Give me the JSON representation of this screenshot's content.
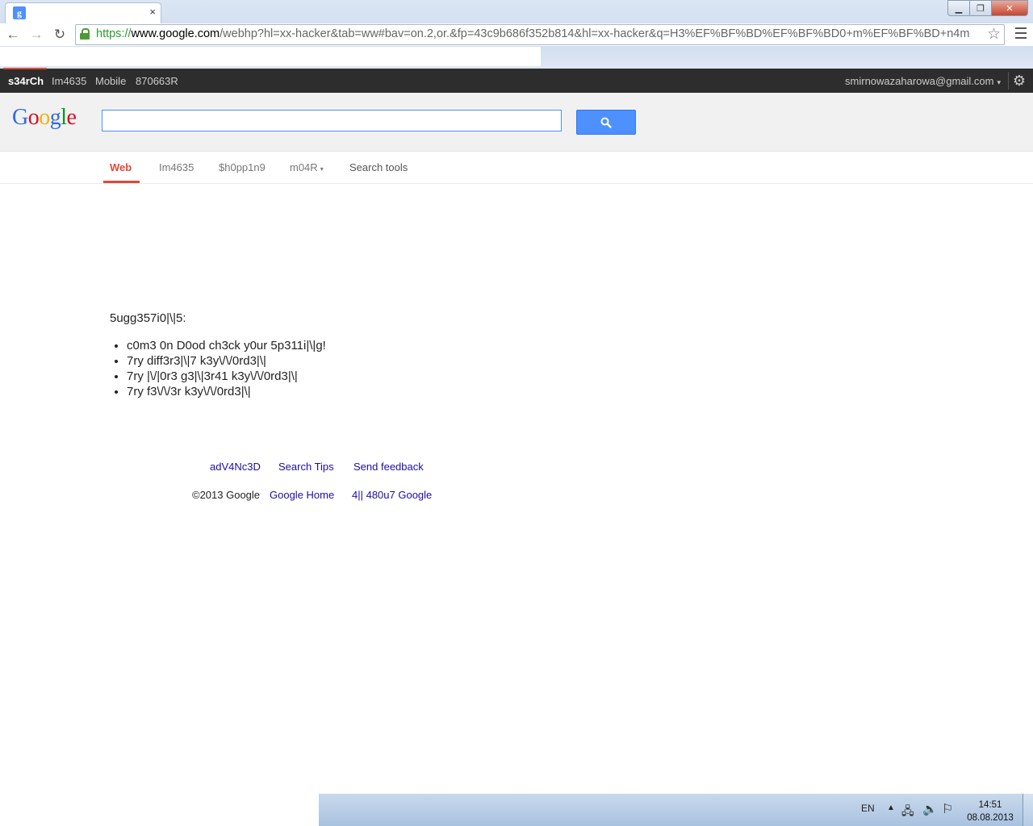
{
  "browser": {
    "tab_favicon": "g",
    "tab_close": "×",
    "window_controls": {
      "minimize": "▁",
      "maximize": "❐",
      "close": "✕"
    },
    "nav": {
      "back": "←",
      "forward": "→",
      "reload": "↻"
    },
    "url_scheme": "https://",
    "url_host": "www.google.com",
    "url_rest": "/webhp?hl=xx-hacker&tab=ww#bav=on.2,or.&fp=43c9b686f352b814&hl=xx-hacker&q=H3%EF%BF%BD%EF%BF%BD0+m%EF%BF%BD+n4m",
    "star": "☆"
  },
  "gbar": {
    "search": "s34rCh",
    "images": "Im4635",
    "mobile": "Mobile",
    "more": "870663R",
    "account": "smirnowazaharowa@gmail.com",
    "account_caret": "▾",
    "gear": "⚙"
  },
  "search": {
    "logo": {
      "G": "G",
      "o1": "o",
      "o2": "o",
      "g": "g",
      "l": "l",
      "e": "e"
    },
    "query": ""
  },
  "tabs": {
    "web": "Web",
    "images": "Im4635",
    "shopping": "$h0pp1n9",
    "more": "m04R",
    "more_caret": "▾",
    "tools": "Search tools"
  },
  "suggestions": {
    "heading": "5ugg357i0|\\|5:",
    "items": [
      "c0m3 0n D0od ch3ck y0ur 5p311i|\\|g!",
      "7ry diff3r3|\\|7 k3y\\/\\/0rd3|\\|",
      "7ry |\\/|0r3 g3|\\|3r41 k3y\\/\\/0rd3|\\|",
      "7ry f3\\/\\/3r k3y\\/\\/0rd3|\\|"
    ]
  },
  "footer": {
    "advanced": "adV4Nc3D",
    "tips": "Search Tips",
    "feedback": "Send feedback",
    "copyright": "©2013 Google",
    "home": "Google Home",
    "about": "4|| 480u7 Google"
  },
  "taskbar": {
    "lang": "EN",
    "tray_up": "▲",
    "network": "🖧",
    "volume": "🔈",
    "flag": "⚐",
    "time": "14:51",
    "date": "08.08.2013"
  }
}
